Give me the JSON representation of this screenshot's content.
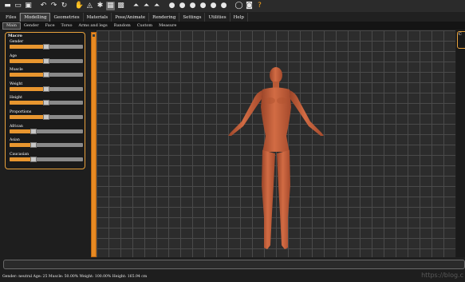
{
  "toolbar": {
    "buttons": [
      {
        "name": "new-file-icon",
        "glyph": "▬"
      },
      {
        "name": "save-file-icon",
        "glyph": "▭"
      },
      {
        "name": "export-icon",
        "glyph": "▣"
      },
      {
        "name": "undo-icon",
        "glyph": "↶"
      },
      {
        "name": "redo-icon",
        "glyph": "↷"
      },
      {
        "name": "reset-icon",
        "glyph": "↻"
      },
      {
        "name": "pose-icon",
        "glyph": "✋"
      },
      {
        "name": "smooth-icon",
        "glyph": "◬"
      },
      {
        "name": "skeleton-icon",
        "glyph": "✱"
      },
      {
        "name": "wireframe-icon",
        "glyph": "▦"
      },
      {
        "name": "checker-icon",
        "glyph": "▩"
      },
      {
        "name": "front-view-icon",
        "glyph": "⏶"
      },
      {
        "name": "back-view-icon",
        "glyph": "⏶"
      },
      {
        "name": "side-view-icon",
        "glyph": "⏶"
      },
      {
        "name": "head-front-icon",
        "glyph": "●"
      },
      {
        "name": "head-back-icon",
        "glyph": "●"
      },
      {
        "name": "head-left-icon",
        "glyph": "●"
      },
      {
        "name": "head-right-icon",
        "glyph": "●"
      },
      {
        "name": "head-top-icon",
        "glyph": "●"
      },
      {
        "name": "head-bottom-icon",
        "glyph": "●"
      },
      {
        "name": "reset-camera-icon",
        "glyph": "◯"
      },
      {
        "name": "screenshot-icon",
        "glyph": "◙"
      },
      {
        "name": "help-icon",
        "glyph": "?"
      }
    ]
  },
  "menu_tabs": [
    {
      "label": "Files",
      "active": false
    },
    {
      "label": "Modelling",
      "active": true
    },
    {
      "label": "Geometries",
      "active": false
    },
    {
      "label": "Materials",
      "active": false
    },
    {
      "label": "Pose/Animate",
      "active": false
    },
    {
      "label": "Rendering",
      "active": false
    },
    {
      "label": "Settings",
      "active": false
    },
    {
      "label": "Utilities",
      "active": false
    },
    {
      "label": "Help",
      "active": false
    }
  ],
  "sub_tabs": [
    {
      "label": "Main",
      "active": true
    },
    {
      "label": "Gender",
      "active": false
    },
    {
      "label": "Face",
      "active": false
    },
    {
      "label": "Torso",
      "active": false
    },
    {
      "label": "Arms and legs",
      "active": false
    },
    {
      "label": "Random",
      "active": false
    },
    {
      "label": "Custom",
      "active": false
    },
    {
      "label": "Measure",
      "active": false
    }
  ],
  "macro_panel": {
    "title": "Macro",
    "sliders": [
      {
        "label": "Gender",
        "value": 0.5
      },
      {
        "label": "Age",
        "value": 0.5
      },
      {
        "label": "Muscle",
        "value": 0.5
      },
      {
        "label": "Weight",
        "value": 0.5
      },
      {
        "label": "Height",
        "value": 0.5
      },
      {
        "label": "Proportions",
        "value": 0.5
      },
      {
        "label": "African",
        "value": 0.33
      },
      {
        "label": "Asian",
        "value": 0.33
      },
      {
        "label": "Caucasian",
        "value": 0.33
      }
    ]
  },
  "right_panel": {
    "label": "C"
  },
  "status_bar": {
    "text": "Gender: neutral Age: 25 Muscle: 50.00% Weight: 100.00% Height: 165.94 cm"
  },
  "watermark": "https://blog.c",
  "colors": {
    "accent": "#e8962f",
    "panel_border": "#e9a23c",
    "skin": "#c4603a"
  }
}
